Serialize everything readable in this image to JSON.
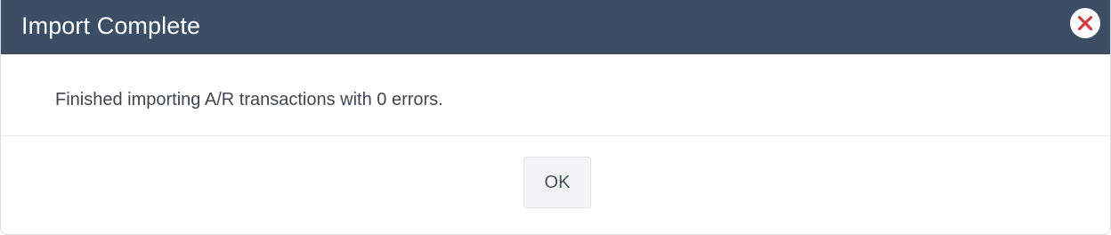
{
  "dialog": {
    "title": "Import Complete",
    "close_icon": "close-circle-icon",
    "message": "Finished importing A/R transactions with 0 errors.",
    "ok_label": "OK"
  },
  "colors": {
    "titlebar_bg": "#3b4e66",
    "close_icon_red": "#d23a3f",
    "button_bg": "#f3f4f5"
  }
}
